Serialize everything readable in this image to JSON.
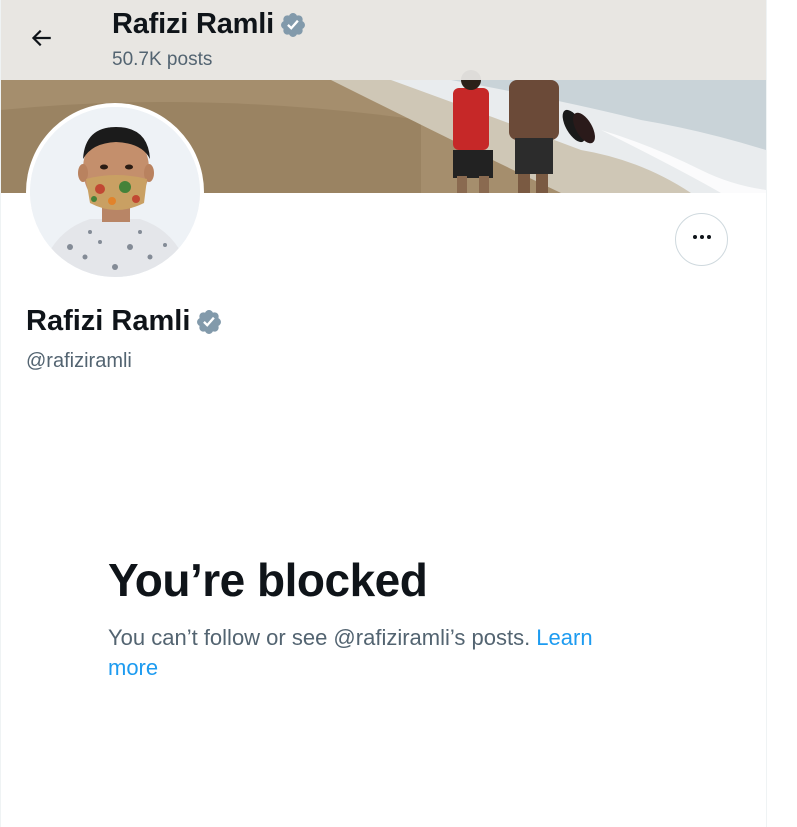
{
  "header": {
    "back_icon": "arrow-left-icon",
    "title": "Rafizi Ramli",
    "posts_count": "50.7K posts"
  },
  "profile": {
    "name": "Rafizi Ramli",
    "handle": "@rafiziramli",
    "verified_icon": "verified-badge-icon",
    "verified_color": "#829aab",
    "more_icon": "more-horizontal-icon"
  },
  "blocked": {
    "title": "You’re blocked",
    "message": "You can’t follow or see @rafiziramli’s posts. ",
    "link_label": "Learn more",
    "link_color": "#1d9bf0"
  }
}
